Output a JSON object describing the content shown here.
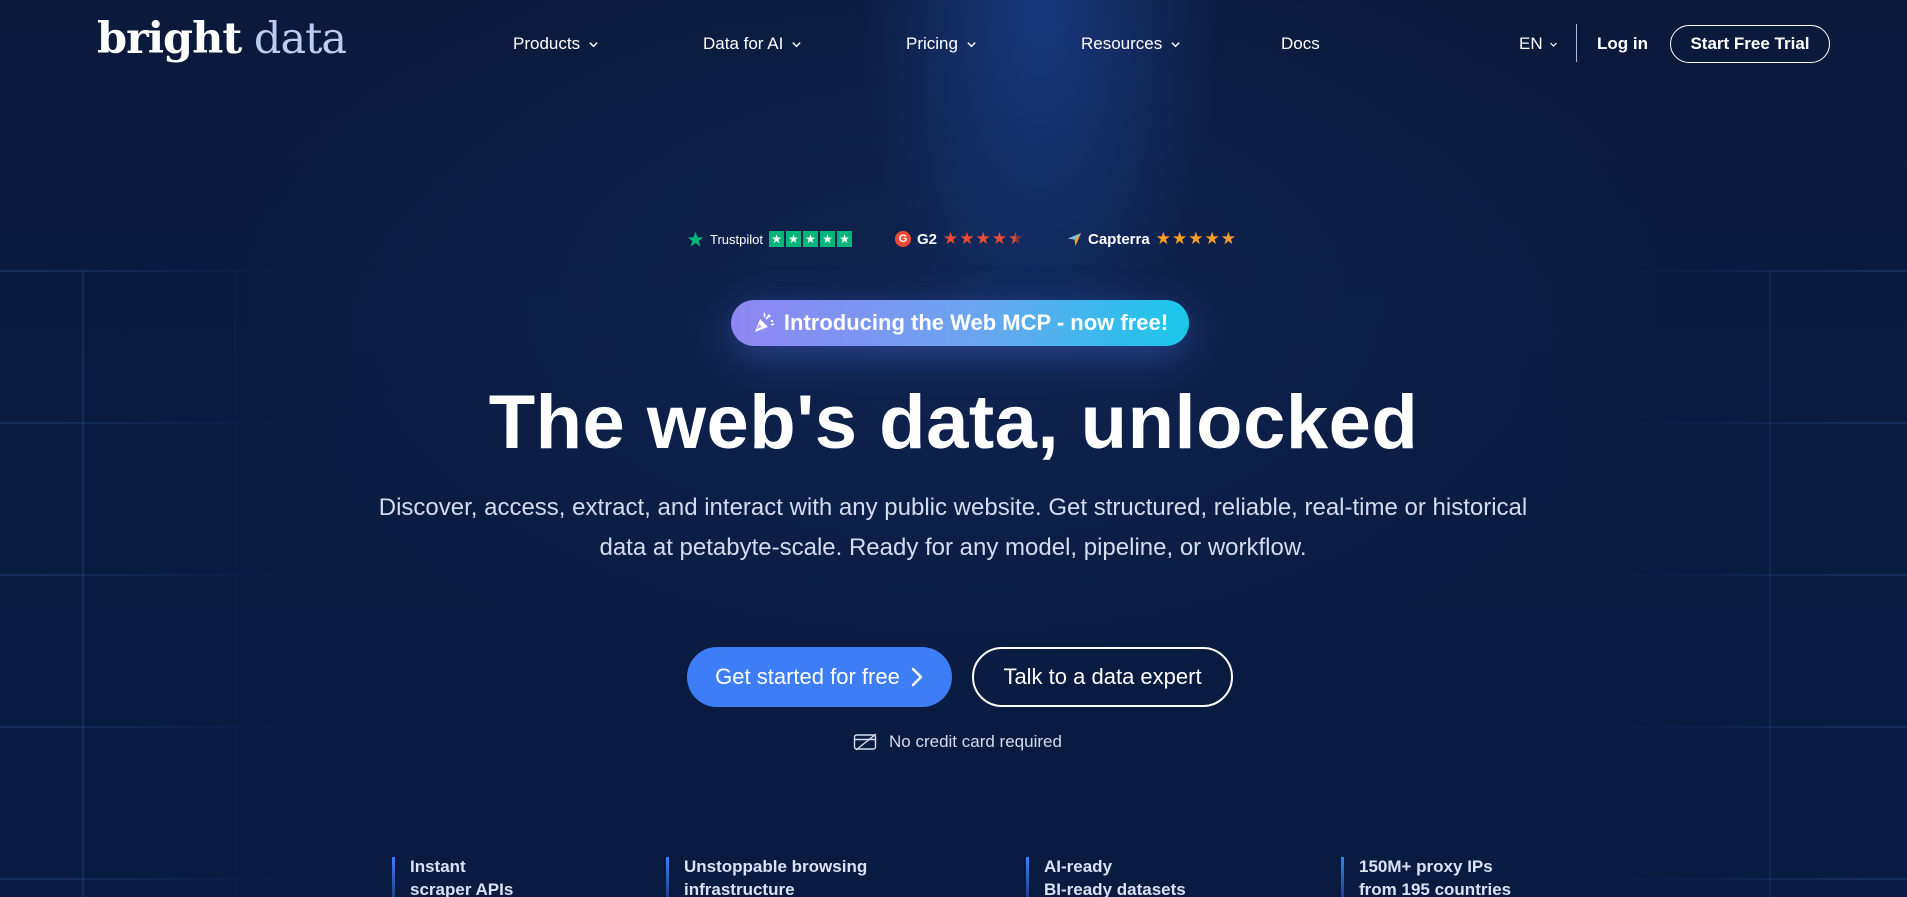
{
  "header": {
    "logo": {
      "word1": "bright",
      "word2": "data"
    },
    "nav": [
      {
        "label": "Products",
        "has_dropdown": true
      },
      {
        "label": "Data for AI",
        "has_dropdown": true
      },
      {
        "label": "Pricing",
        "has_dropdown": true
      },
      {
        "label": "Resources",
        "has_dropdown": true
      },
      {
        "label": "Docs",
        "has_dropdown": false
      }
    ],
    "language": "EN",
    "login_label": "Log in",
    "trial_label": "Start Free Trial"
  },
  "ratings": [
    {
      "name": "Trustpilot",
      "icon": "trustpilot-star-icon",
      "stars": 5
    },
    {
      "name": "G2",
      "icon": "g2-logo-icon",
      "stars": 4.5
    },
    {
      "name": "Capterra",
      "icon": "capterra-logo-icon",
      "stars": 5
    }
  ],
  "promo": {
    "emoji_icon": "party-popper-icon",
    "label": "Introducing the Web MCP - now free!"
  },
  "hero": {
    "headline": "The web's data, unlocked",
    "subtext": "Discover, access, extract, and interact with any public website. Get structured, reliable, real-time or historical data at petabyte-scale. Ready for any model, pipeline, or workflow."
  },
  "cta": {
    "primary_label": "Get started for free",
    "secondary_label": "Talk to a data expert",
    "note": "No credit card required"
  },
  "features": [
    {
      "line1": "Instant",
      "line2": "scraper APIs"
    },
    {
      "line1": "Unstoppable browsing",
      "line2": "infrastructure"
    },
    {
      "line1": "AI-ready",
      "line2": "BI-ready datasets"
    },
    {
      "line1": "150M+ proxy IPs",
      "line2": "from 195 countries"
    }
  ],
  "colors": {
    "background": "#0a1a3c",
    "accent_blue": "#3d7ef6",
    "trustpilot_green": "#00b67a",
    "g2_red": "#ef4a35",
    "capterra_orange": "#ff9d28"
  }
}
